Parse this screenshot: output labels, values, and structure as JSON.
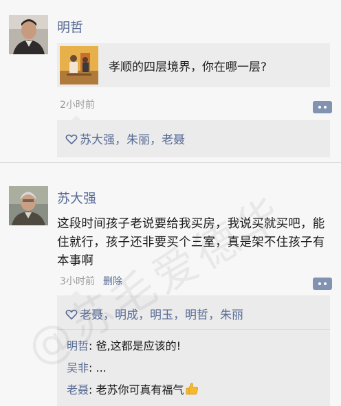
{
  "post1": {
    "username": "明哲",
    "share_title": "孝顺的四层境界，你在哪一层?",
    "time": "2小时前",
    "likes": [
      "苏大强",
      "朱丽",
      "老聂"
    ],
    "separator": "，"
  },
  "post2": {
    "username": "苏大强",
    "text": "这段时间孩子老说要给我买房，我说买就买吧，能住就行，孩子还非要买个三室，真是架不住孩子有本事啊",
    "time": "3小时前",
    "delete_label": "删除",
    "likes": [
      "老聂",
      "明成",
      "明玉",
      "明哲",
      "朱丽"
    ],
    "separator": "，",
    "comments": [
      {
        "name": "明哲",
        "text": ": 爸,这都是应该的!"
      },
      {
        "name": "吴非",
        "text": ": ..."
      },
      {
        "name": "老聂",
        "text": ": 老苏你可真有福气"
      }
    ]
  },
  "watermark": "@苏毛爱德华",
  "colors": {
    "link": "#576b95",
    "background": "#f7f7f7",
    "panel": "#ebebeb",
    "meta": "#9a9a9a"
  },
  "icons": {
    "like": "heart-outline-icon",
    "more": "comment-more-icon",
    "emoji": "thumbs-up-icon"
  }
}
